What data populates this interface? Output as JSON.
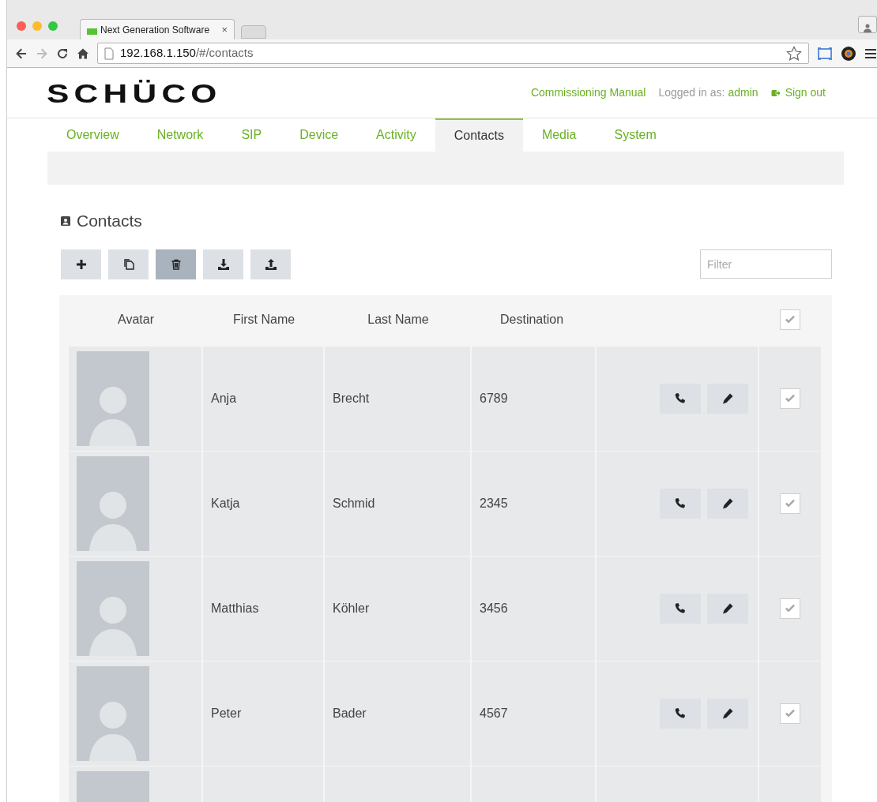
{
  "browser": {
    "tab_title": "Next Generation Software",
    "tab_close": "×",
    "url_host": "192.168.1.150",
    "url_path": "/#/contacts"
  },
  "header": {
    "logo": "SCHÜCO",
    "manual_link": "Commissioning Manual",
    "logged_in_label": "Logged in as:",
    "user": "admin",
    "sign_out": "Sign out"
  },
  "tabs": [
    {
      "label": "Overview",
      "selected": false
    },
    {
      "label": "Network",
      "selected": false
    },
    {
      "label": "SIP",
      "selected": false
    },
    {
      "label": "Device",
      "selected": false
    },
    {
      "label": "Activity",
      "selected": false
    },
    {
      "label": "Contacts",
      "selected": true
    },
    {
      "label": "Media",
      "selected": false
    },
    {
      "label": "System",
      "selected": false
    }
  ],
  "section_title": "Contacts",
  "toolbar": [
    {
      "kind": "add",
      "active": false
    },
    {
      "kind": "copy",
      "active": false
    },
    {
      "kind": "delete",
      "active": true
    },
    {
      "kind": "download",
      "active": false
    },
    {
      "kind": "upload",
      "active": false
    }
  ],
  "filter": {
    "placeholder": "Filter"
  },
  "table": {
    "columns": [
      "Avatar",
      "First Name",
      "Last Name",
      "Destination"
    ],
    "header_checked": true,
    "rows": [
      {
        "kind": "full",
        "first_name": "Anja",
        "last_name": "Brecht",
        "destination": "6789",
        "checked": true
      },
      {
        "kind": "full",
        "first_name": "Katja",
        "last_name": "Schmid",
        "destination": "2345",
        "checked": true
      },
      {
        "kind": "full",
        "first_name": "Matthias",
        "last_name": "Köhler",
        "destination": "3456",
        "checked": true
      },
      {
        "kind": "full",
        "first_name": "Peter",
        "last_name": "Bader",
        "destination": "4567",
        "checked": true
      },
      {
        "kind": "partial"
      }
    ]
  }
}
